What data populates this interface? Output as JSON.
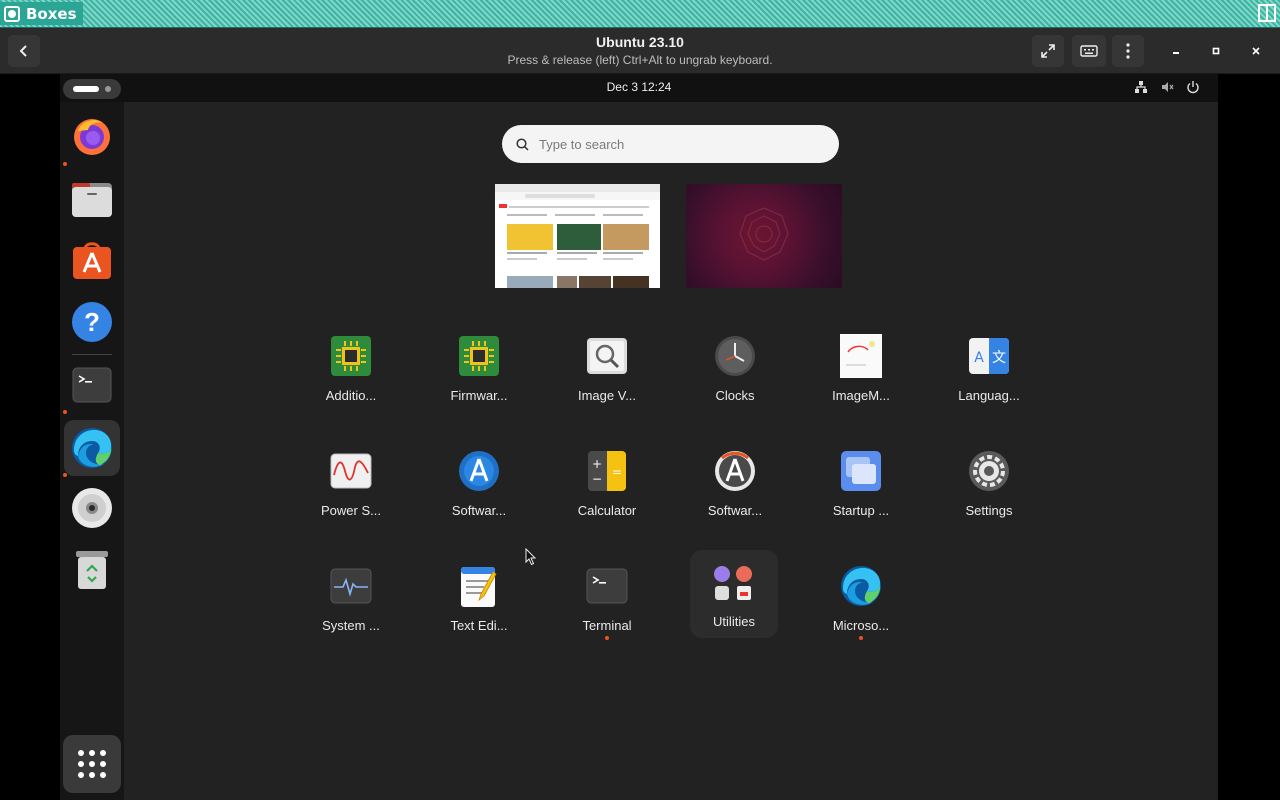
{
  "window": {
    "title": "Boxes"
  },
  "header": {
    "vm_name": "Ubuntu 23.10",
    "hint": "Press & release (left) Ctrl+Alt to ungrab keyboard."
  },
  "vm": {
    "clock": "Dec 3  12:24",
    "search_placeholder": "Type to search"
  },
  "dock": {
    "items": [
      {
        "name": "firefox",
        "running": true
      },
      {
        "name": "files",
        "running": false
      },
      {
        "name": "app-center",
        "running": false
      },
      {
        "name": "help",
        "running": false
      },
      {
        "name": "terminal",
        "running": true
      },
      {
        "name": "microsoft-edge",
        "running": true,
        "active": true
      },
      {
        "name": "optical-disc",
        "running": false
      },
      {
        "name": "trash",
        "running": false
      }
    ]
  },
  "apps": [
    {
      "label": "Additio...",
      "icon": "chip-icon"
    },
    {
      "label": "Firmwar...",
      "icon": "chip-icon"
    },
    {
      "label": "Image V...",
      "icon": "image-viewer-icon"
    },
    {
      "label": "Clocks",
      "icon": "clock-icon"
    },
    {
      "label": "ImageM...",
      "icon": "imagemagick-icon"
    },
    {
      "label": "Languag...",
      "icon": "language-icon"
    },
    {
      "label": "Power S...",
      "icon": "power-stats-icon"
    },
    {
      "label": "Softwar...",
      "icon": "software-updater-icon"
    },
    {
      "label": "Calculator",
      "icon": "calculator-icon"
    },
    {
      "label": "Softwar...",
      "icon": "software-properties-icon"
    },
    {
      "label": "Startup ...",
      "icon": "startup-icon"
    },
    {
      "label": "Settings",
      "icon": "settings-icon"
    },
    {
      "label": "System ...",
      "icon": "system-monitor-icon"
    },
    {
      "label": "Text Edi...",
      "icon": "text-editor-icon"
    },
    {
      "label": "Terminal",
      "icon": "terminal-icon",
      "running": true
    },
    {
      "label": "Utilities",
      "icon": "folder-icon",
      "folder": true
    },
    {
      "label": "Microso...",
      "icon": "edge-icon",
      "running": true
    }
  ],
  "colors": {
    "accent": "#e95420",
    "wm_bar": "#3fb3a3"
  }
}
